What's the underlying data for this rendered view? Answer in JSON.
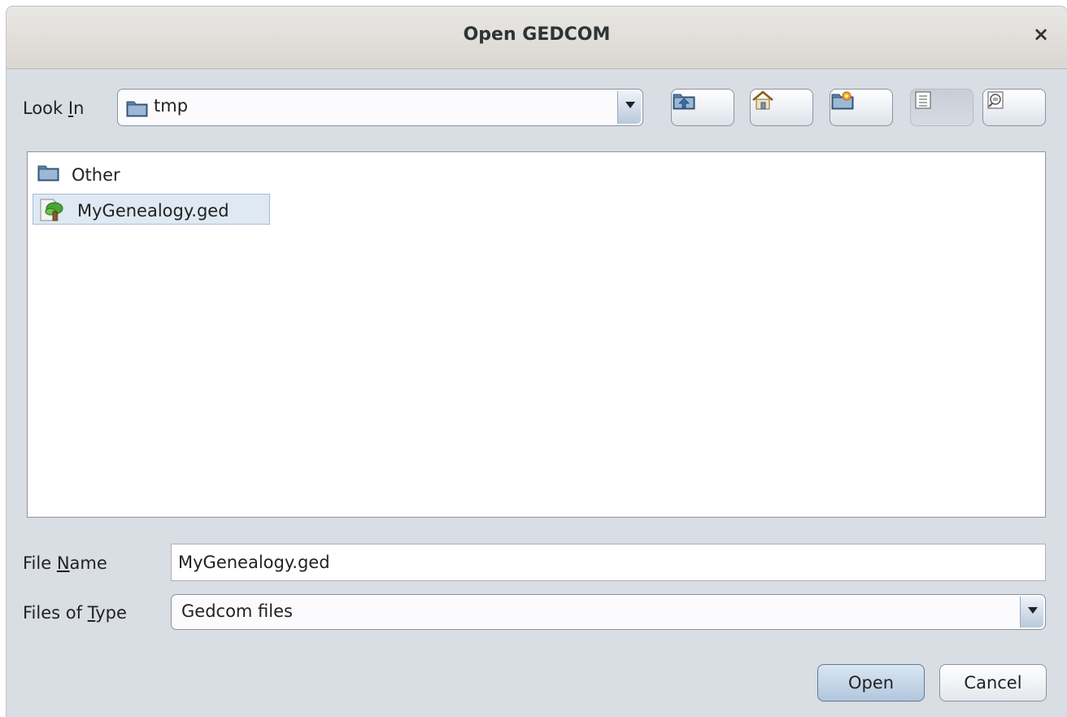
{
  "window": {
    "title": "Open GEDCOM",
    "close_label": "×"
  },
  "look_in": {
    "label_pre": "Look ",
    "label_mnemonic": "I",
    "label_post": "n",
    "value": "tmp",
    "toolbar_icons": [
      "up-one-level-icon",
      "home-icon",
      "new-folder-icon",
      "list-view-icon",
      "details-view-icon"
    ]
  },
  "files": [
    {
      "name": "Other",
      "icon": "folder-icon",
      "selected": false
    },
    {
      "name": "MyGenealogy.ged",
      "icon": "gedcom-file-icon",
      "selected": true
    }
  ],
  "file_name": {
    "label_pre": "File ",
    "label_mnemonic": "N",
    "label_post": "ame",
    "value": "MyGenealogy.ged"
  },
  "file_type": {
    "label_pre": "Files of ",
    "label_mnemonic": "T",
    "label_post": "ype",
    "value": "Gedcom files"
  },
  "buttons": {
    "open": "Open",
    "cancel": "Cancel"
  }
}
